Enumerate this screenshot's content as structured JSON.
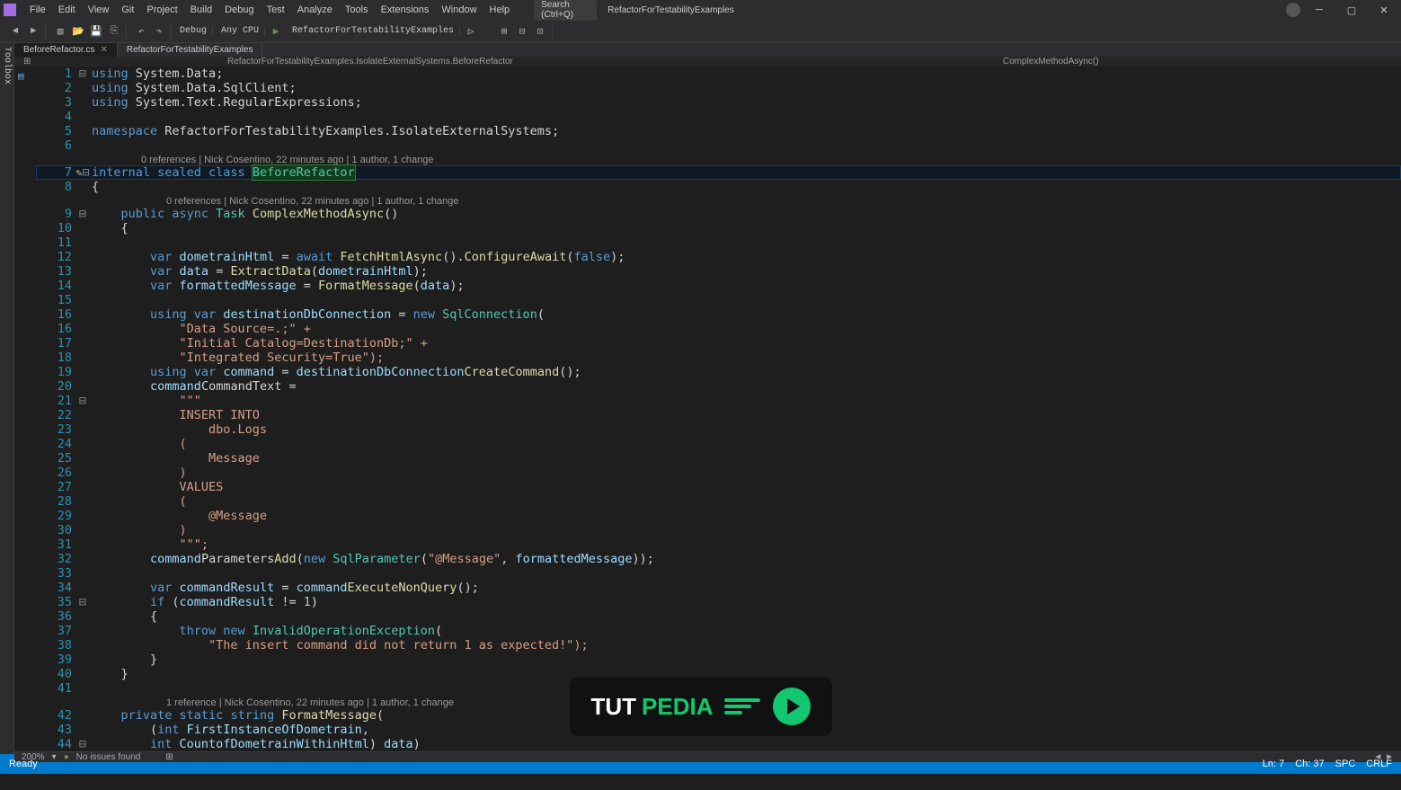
{
  "menu": {
    "items": [
      "File",
      "Edit",
      "View",
      "Git",
      "Project",
      "Build",
      "Debug",
      "Test",
      "Analyze",
      "Tools",
      "Extensions",
      "Window",
      "Help"
    ],
    "search_placeholder": "Search (Ctrl+Q)",
    "solution": "RefactorForTestabilityExamples"
  },
  "toolbar": {
    "config": "Debug",
    "platform": "Any CPU",
    "start": "RefactorForTestabilityExamples"
  },
  "tabs": [
    {
      "label": "BeforeRefactor.cs",
      "active": true
    },
    {
      "label": "RefactorForTestabilityExamples",
      "active": false
    }
  ],
  "breadcrumbs": {
    "left": "RefactorForTestabilityExamples.IsolateExternalSystems.BeforeRefactor",
    "right": "ComplexMethodAsync()"
  },
  "codelens1": "0 references | Nick Cosentino, 22 minutes ago | 1 author, 1 change",
  "codelens2": "0 references | Nick Cosentino, 22 minutes ago | 1 author, 1 change",
  "codelens3": "1 reference | Nick Cosentino, 22 minutes ago | 1 author, 1 change",
  "code": {
    "l1": {
      "a": "using ",
      "b": "System.Data",
      ";": ";"
    },
    "l2": {
      "a": "using ",
      "b": "System.Data.SqlClient",
      ";": ";"
    },
    "l3": {
      "a": "using ",
      "b": "System.Text.RegularExpressions",
      ";": ";"
    },
    "l5": {
      "a": "namespace ",
      "b": "RefactorForTestabilityExamples.IsolateExternalSystems",
      ";": ";"
    },
    "l7": {
      "a": "internal sealed class ",
      "b": "BeforeRefactor"
    },
    "l8": "{",
    "l9": {
      "a": "    public async ",
      "t": "Task ",
      "m": "ComplexMethodAsync",
      "p": "()"
    },
    "l10": "    {",
    "l12": {
      "a": "        var ",
      "v": "dometrainHtml",
      "eq": " = ",
      "aw": "await ",
      "m": "FetchHtmlAsync",
      "p": "().",
      "m2": "ConfigureAwait",
      "p2": "(",
      "kw": "false",
      "p3": ");"
    },
    "l13": {
      "a": "        var ",
      "v": "data",
      "eq": " = ",
      "m": "ExtractData",
      "p": "(",
      "v2": "dometrainHtml",
      "p2": ");"
    },
    "l14": {
      "a": "        var ",
      "v": "formattedMessage",
      "eq": " = ",
      "m": "FormatMessage",
      "p": "(",
      "v2": "data",
      "p2": ");"
    },
    "l15": {
      "a": "        using var ",
      "v": "destinationDbConnection",
      "eq": " = ",
      "nw": "new ",
      "t": "SqlConnection",
      "p": "("
    },
    "l16": "            \"Data Source=.;\" +",
    "l17": "            \"Initial Catalog=DestinationDb;\" +",
    "l18": "            \"Integrated Security=True\");",
    "l19": {
      "a": "        using var ",
      "v": "command",
      "eq": " = ",
      "v2": "destinationDbConnection",
      ".": ".",
      "m": "CreateCommand",
      "p": "();"
    },
    "l20": {
      "a": "        ",
      "v": "command",
      ".": ".",
      "p": "CommandText",
      "eq": " ="
    },
    "l21": "            \"\"\"",
    "l22": "            INSERT INTO",
    "l23": "                dbo.Logs",
    "l24": "            (",
    "l25": "                Message",
    "l26": "            )",
    "l27": "            VALUES",
    "l28": "            (",
    "l29": "                @Message",
    "l30": "            )",
    "l31": "            \"\"\";",
    "l32": {
      "a": "        ",
      "v": "command",
      ".": ".",
      "p": "Parameters",
      ".2": ".",
      "m": "Add",
      "p1": "(",
      "nw": "new ",
      "t": "SqlParameter",
      "p2": "(",
      "s": "\"@Message\"",
      "c": ", ",
      "v2": "formattedMessage",
      "p3": "));"
    },
    "l34": {
      "a": "        var ",
      "v": "commandResult",
      "eq": " = ",
      "v2": "command",
      ".": ".",
      "m": "ExecuteNonQuery",
      "p": "();"
    },
    "l35": {
      "a": "        if ",
      "p": "(",
      "v": "commandResult",
      "op": " != ",
      "n": "1",
      "p2": ")"
    },
    "l36": "        {",
    "l37": {
      "a": "            throw new ",
      "t": "InvalidOperationException",
      "p": "("
    },
    "l38": "                \"The insert command did not return 1 as expected!\");",
    "l39": "        }",
    "l40": "    }",
    "l42": {
      "a": "    private static ",
      "t": "string ",
      "m": "FormatMessage",
      "p": "("
    },
    "l43": {
      "a": "        (",
      "t": "int ",
      "v": "FirstInstanceOfDometrain",
      "p": ","
    },
    "l44": {
      "a": "        ",
      "t": "int ",
      "v": "CountofDometrainWithinHtml",
      "p": ") ",
      "v2": "data",
      "p2": ")"
    }
  },
  "bottom": {
    "percent": "200%",
    "issues": "No issues found"
  },
  "statusbar": {
    "left": "Ready",
    "right": [
      "Ln: 7",
      "Ch: 37",
      "SPC",
      "CRLF"
    ]
  },
  "watermark": {
    "t": "TUT",
    "p": "PEDIA"
  }
}
